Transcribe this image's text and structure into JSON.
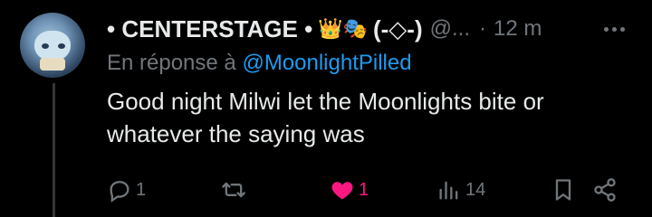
{
  "tweet": {
    "display_name": "• CENTERSTAGE •",
    "emoji": "👑🎭",
    "symbol": "(-◇-)",
    "handle": "@...",
    "separator": "·",
    "time": "12 m",
    "reply_prefix": "En réponse à",
    "reply_mention": "@MoonlightPilled",
    "text": "Good night Milwi let the Moonlights bite or whatever the saying was"
  },
  "actions": {
    "replies": "1",
    "retweets": "",
    "likes": "1",
    "views": "14"
  },
  "colors": {
    "background": "#000000",
    "text": "#e7e9ea",
    "muted": "#71767b",
    "link": "#1d9bf0",
    "like": "#f91880"
  },
  "icons": [
    "more-icon",
    "reply-icon",
    "retweet-icon",
    "like-icon",
    "views-icon",
    "bookmark-icon",
    "share-icon"
  ]
}
